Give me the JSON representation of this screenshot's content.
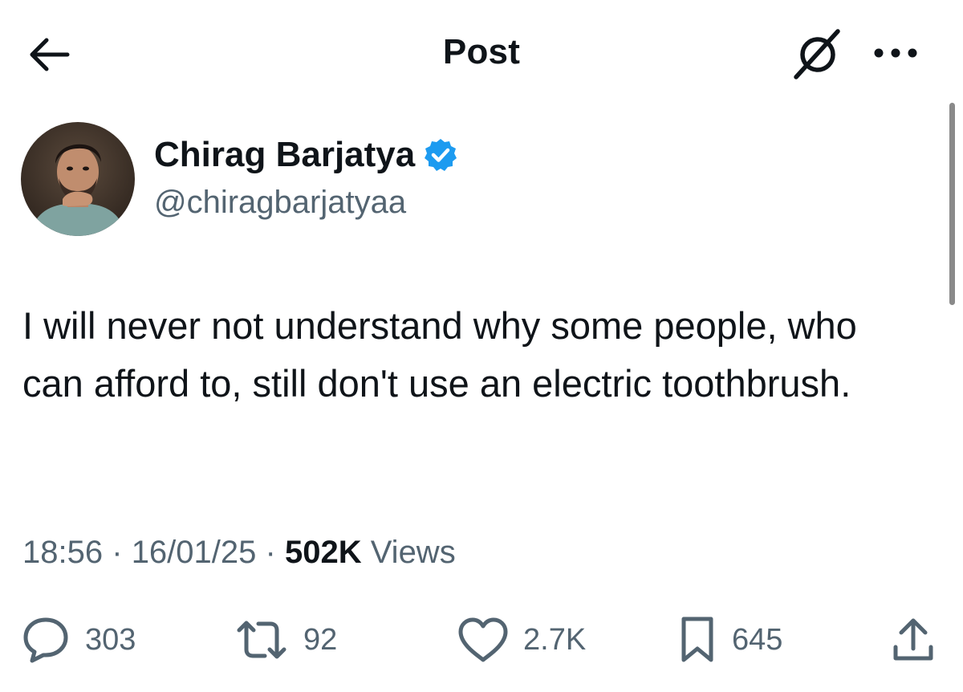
{
  "header": {
    "title": "Post",
    "back_icon": "arrow-left-icon",
    "grok_icon": "grok-slash-circle-icon",
    "more_icon": "more-dots-icon"
  },
  "author": {
    "display_name": "Chirag Barjatya",
    "handle": "@chiragbarjatyaa",
    "verified": true,
    "verified_color": "#1d9bf0"
  },
  "tweet": {
    "text": "I will never not understand why some people, who can afford to, still don't use an electric toothbrush."
  },
  "meta": {
    "time": "18:56",
    "separator": "·",
    "date": "16/01/25",
    "views_count": "502K",
    "views_label": "Views"
  },
  "actions": {
    "replies": "303",
    "reposts": "92",
    "likes": "2.7K",
    "bookmarks": "645"
  },
  "colors": {
    "text": "#0f1419",
    "secondary": "#536471",
    "accent": "#1d9bf0"
  }
}
